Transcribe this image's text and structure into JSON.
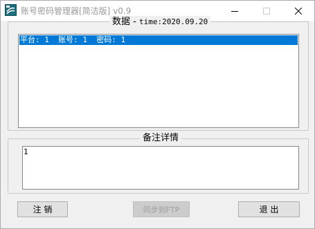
{
  "window": {
    "title": "账号密码管理器[简洁版] v0.9"
  },
  "data_group": {
    "label_prefix": "数据 - ",
    "label_time": "time:2020.09.20",
    "list_items": [
      "平台: 1  账号: 1  密码: 1"
    ],
    "selected_index": 0
  },
  "notes_group": {
    "label": "备注详情",
    "content": "1"
  },
  "buttons": {
    "logout": "注 销",
    "sync_ftp": "同步到FTP",
    "exit": "退 出"
  },
  "colors": {
    "selection": "#0078d7",
    "window_bg": "#f0f0f0",
    "title_text": "#999999"
  },
  "icons": {
    "app": "app-icon",
    "minimize": "minimize-icon",
    "maximize": "maximize-icon",
    "close": "close-icon"
  }
}
